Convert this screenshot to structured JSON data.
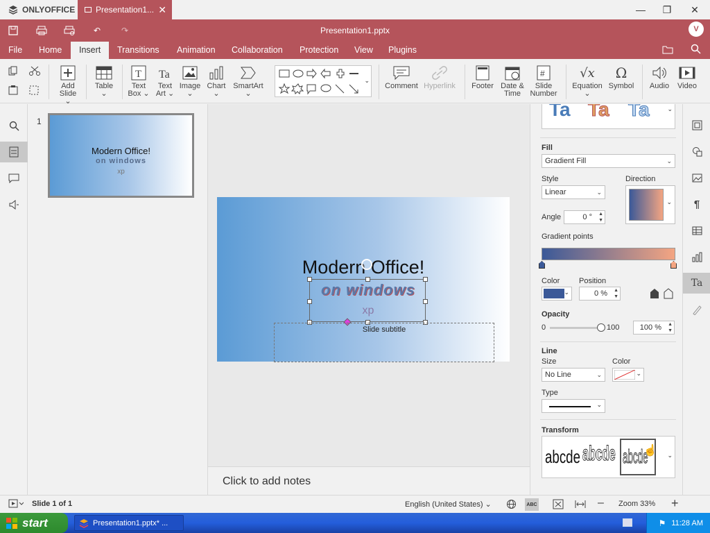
{
  "app": {
    "name": "ONLYOFFICE",
    "tab_title": "Presentation1...",
    "doc_title": "Presentation1.pptx",
    "avatar_initial": "V"
  },
  "menu": {
    "items": [
      "File",
      "Home",
      "Insert",
      "Transitions",
      "Animation",
      "Collaboration",
      "Protection",
      "View",
      "Plugins"
    ],
    "active": "Insert"
  },
  "toolbar": {
    "add_slide": [
      "Add",
      "Slide"
    ],
    "table": "Table",
    "text_box": [
      "Text",
      "Box"
    ],
    "text_art": [
      "Text",
      "Art"
    ],
    "image": "Image",
    "chart": "Chart",
    "smartart": "SmartArt",
    "comment": "Comment",
    "hyperlink": "Hyperlink",
    "footer": "Footer",
    "date_time": [
      "Date &",
      "Time"
    ],
    "slide_number": [
      "Slide",
      "Number"
    ],
    "equation": "Equation",
    "symbol": "Symbol",
    "audio": "Audio",
    "video": "Video"
  },
  "thumbnails": [
    {
      "number": "1",
      "title": "Modern Office!",
      "sub1": "on windows",
      "sub2": "xp"
    }
  ],
  "slide": {
    "title": "Modern Office!",
    "wordart": "on windows",
    "xp": "xp",
    "subtitle": "Slide subtitle"
  },
  "notes": {
    "placeholder": "Click to add notes"
  },
  "panel": {
    "fill_label": "Fill",
    "fill_value": "Gradient Fill",
    "style_label": "Style",
    "style_value": "Linear",
    "direction_label": "Direction",
    "angle_label": "Angle",
    "angle_value": "0 °",
    "gradient_points_label": "Gradient points",
    "color_label": "Color",
    "position_label": "Position",
    "position_value": "0 %",
    "opacity_label": "Opacity",
    "opacity_min": "0",
    "opacity_max": "100",
    "opacity_value": "100 %",
    "opacity_level": 1.0,
    "line_label": "Line",
    "size_label": "Size",
    "size_value": "No Line",
    "line_color_label": "Color",
    "type_label": "Type",
    "transform_label": "Transform",
    "transform_samples": [
      "abcde",
      "abcde",
      "abcde"
    ],
    "textart_samples": [
      "Ta",
      "Ta",
      "Ta"
    ],
    "colors": {
      "grad_start": "#3b5998",
      "grad_end": "#f4a582",
      "color_swatch": "#3b5998"
    }
  },
  "status": {
    "slide_info": "Slide 1 of 1",
    "language": "English (United States)",
    "zoom": "Zoom 33%"
  },
  "taskbar": {
    "start": "start",
    "task": "Presentation1.pptx* ...",
    "time": "11:28 AM"
  },
  "accent": "#b5545b"
}
